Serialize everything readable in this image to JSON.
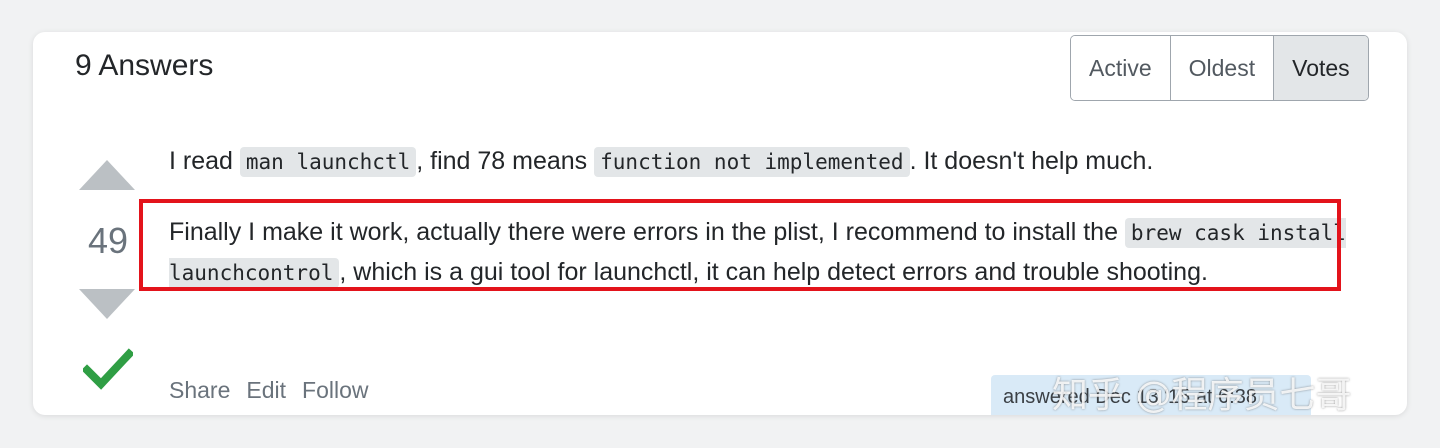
{
  "header": {
    "answers_title": "9 Answers"
  },
  "sort_tabs": [
    {
      "label": "Active",
      "selected": false
    },
    {
      "label": "Oldest",
      "selected": false
    },
    {
      "label": "Votes",
      "selected": true
    }
  ],
  "vote": {
    "count": "49",
    "accepted": true
  },
  "answer": {
    "p1": {
      "t1": "I read ",
      "code1": "man launchctl",
      "t2": ", find 78 means ",
      "code2": "function not implemented",
      "t3": ". It doesn't help much."
    },
    "p2": {
      "t1": "Finally I make it work, actually there were errors in the plist, I recommend to install the ",
      "code1": "brew cask install launchcontrol",
      "t2": ", which is a gui tool for launchctl, it can help detect errors and trouble shooting."
    }
  },
  "post_menu": {
    "share": "Share",
    "edit": "Edit",
    "follow": "Follow"
  },
  "signature": {
    "answered": "answered Dec 13 '15 at 6:38"
  },
  "watermark": "知乎 @程序员七哥",
  "colors": {
    "highlight_border": "#e3131b",
    "accepted_check": "#2f9e44",
    "vote_arrow": "#bbc0c4",
    "signature_bg": "#d9eaf7"
  }
}
